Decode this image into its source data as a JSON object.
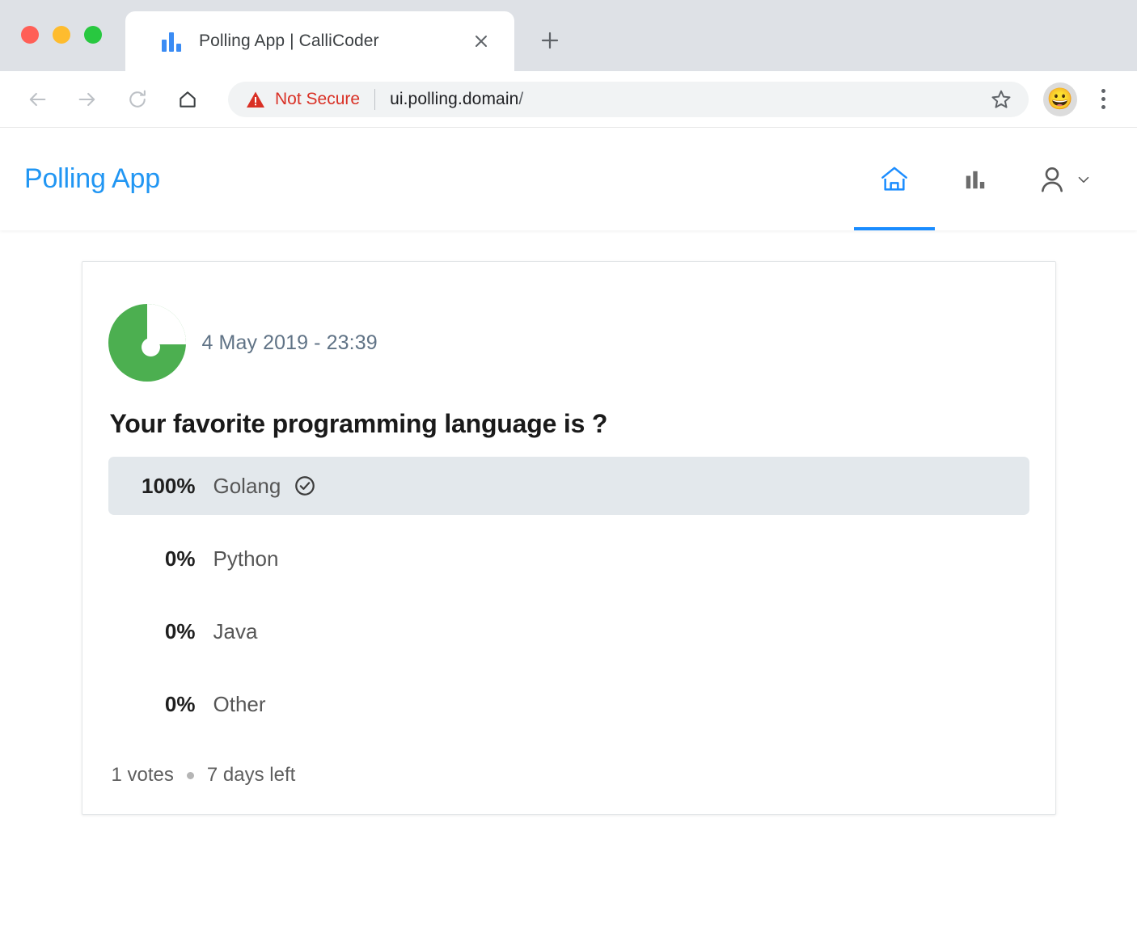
{
  "browser": {
    "tab": {
      "title": "Polling App | CalliCoder",
      "favicon": "bar-chart-icon",
      "close_label": "×"
    },
    "new_tab_label": "+",
    "toolbar": {
      "back_label": "←",
      "forward_label": "→",
      "reload_label": "⟳",
      "home_label": "⌂",
      "security_text": "Not Secure",
      "url": "ui.polling.domain",
      "url_slash": "/",
      "bookmark_icon": "star-icon",
      "profile_avatar": "😀",
      "menu_icon": "kebab-menu-icon"
    }
  },
  "app": {
    "brand": "Polling App",
    "nav": [
      {
        "name": "home",
        "icon": "home-icon",
        "active": true
      },
      {
        "name": "polls",
        "icon": "bar-chart-icon",
        "active": false
      },
      {
        "name": "profile",
        "icon": "user-icon",
        "active": false,
        "chevron": "chevron-down-icon"
      }
    ]
  },
  "poll": {
    "author_avatar_color": "#4caf50",
    "date": "4 May 2019 - 23:39",
    "question": "Your favorite programming language is ?",
    "options": [
      {
        "percent": "100%",
        "label": "Golang",
        "value": 100,
        "selected": true
      },
      {
        "percent": "0%",
        "label": "Python",
        "value": 0,
        "selected": false
      },
      {
        "percent": "0%",
        "label": "Java",
        "value": 0,
        "selected": false
      },
      {
        "percent": "0%",
        "label": "Other",
        "value": 0,
        "selected": false
      }
    ],
    "votes_text": "1 votes",
    "expiry_text": "7 days left"
  },
  "colors": {
    "brand_blue": "#2196f3",
    "active_blue": "#1a8cff",
    "avatar_green": "#4caf50",
    "bar_fill": "#e3e8ec",
    "not_secure_red": "#d93025"
  }
}
